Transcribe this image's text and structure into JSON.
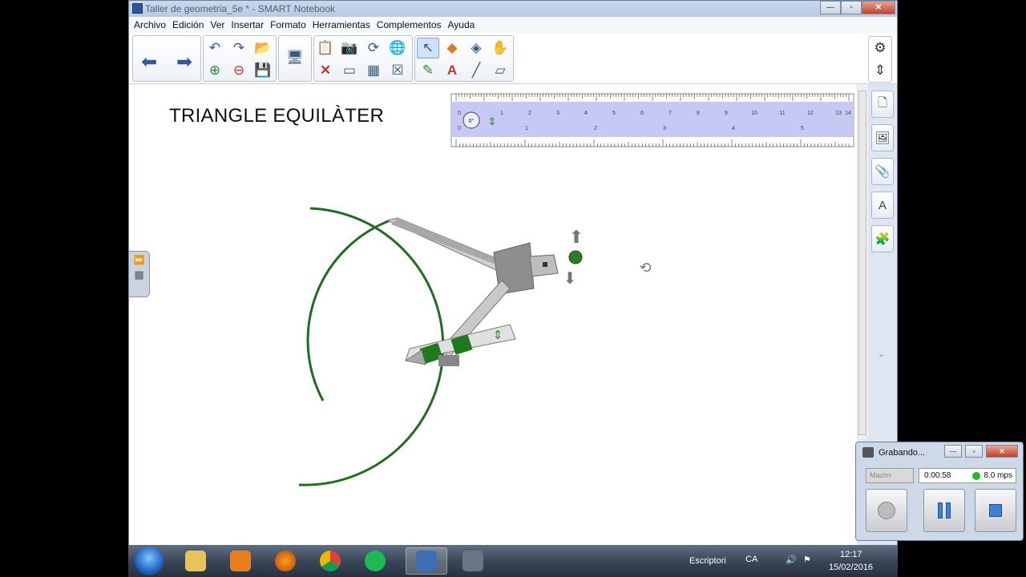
{
  "window": {
    "title": "Taller de geometria_5e * - SMART Notebook",
    "controls": {
      "minimize": "—",
      "maximize": "▫",
      "close": "✕"
    }
  },
  "menu": [
    "Archivo",
    "Edición",
    "Ver",
    "Insertar",
    "Formato",
    "Herramientas",
    "Complementos",
    "Ayuda"
  ],
  "toolbar": {
    "back_icon": "back-arrow-icon",
    "forward_icon": "forward-arrow-icon",
    "settings_icon": "gear-icon"
  },
  "page": {
    "title": "TRIANGLE EQUILÀTER"
  },
  "ruler": {
    "top_marks": [
      "0",
      "1",
      "2",
      "3",
      "4",
      "5",
      "6",
      "7",
      "8",
      "9",
      "10",
      "11",
      "12",
      "13",
      "14"
    ],
    "bottom_marks": [
      "0",
      "1",
      "2",
      "3",
      "4",
      "5"
    ],
    "angle_label": "0°"
  },
  "recorder": {
    "title": "Grabando...",
    "quality": "Mazim",
    "elapsed": "0:00:58",
    "rate": "8.0 mps"
  },
  "taskbar": {
    "apps": [
      "explorer",
      "media-player",
      "firefox",
      "chrome",
      "spotify",
      "smart-notebook",
      "smart-recorder"
    ],
    "tray_label": "Escriptori",
    "lang": "CA",
    "time": "12:17",
    "date": "15/02/2016"
  },
  "colors": {
    "compass_arc": "#1f6e1f",
    "ruler_fill": "#c7c8f3",
    "accent": "#2f5b9a"
  }
}
